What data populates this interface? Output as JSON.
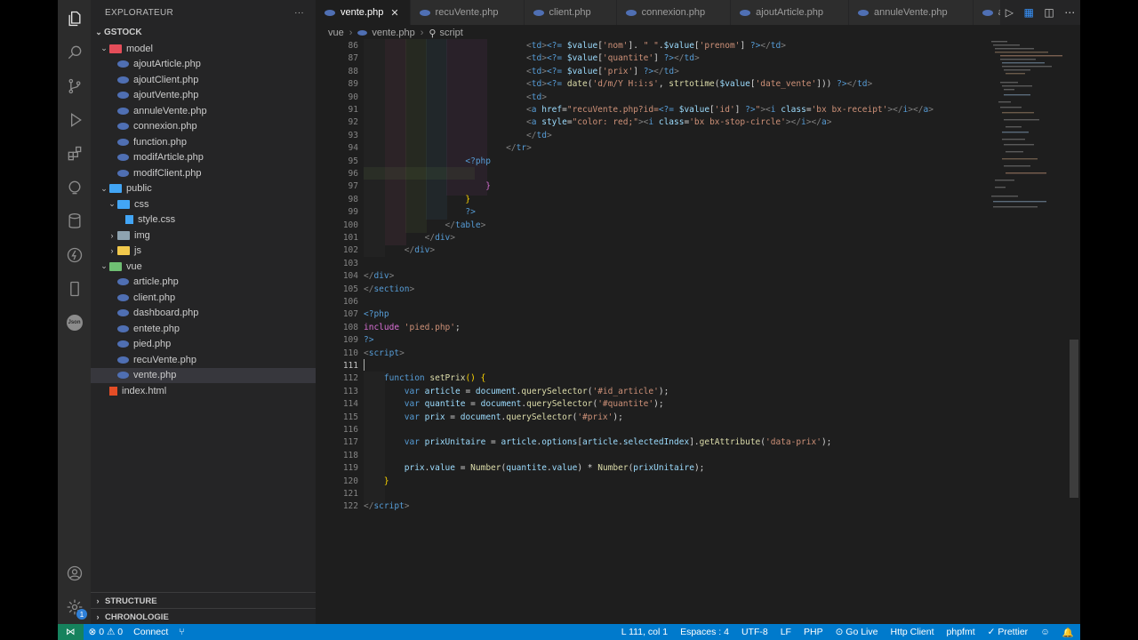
{
  "sidebar": {
    "title": "EXPLORATEUR",
    "more": "···",
    "root": "GSTOCK",
    "tree": [
      {
        "label": "model",
        "kind": "folder-red",
        "depth": 1,
        "chev": "⌄"
      },
      {
        "label": "ajoutArticle.php",
        "kind": "php",
        "depth": 2
      },
      {
        "label": "ajoutClient.php",
        "kind": "php",
        "depth": 2
      },
      {
        "label": "ajoutVente.php",
        "kind": "php",
        "depth": 2
      },
      {
        "label": "annuleVente.php",
        "kind": "php",
        "depth": 2
      },
      {
        "label": "connexion.php",
        "kind": "php",
        "depth": 2
      },
      {
        "label": "function.php",
        "kind": "php",
        "depth": 2
      },
      {
        "label": "modifArticle.php",
        "kind": "php",
        "depth": 2
      },
      {
        "label": "modifClient.php",
        "kind": "php",
        "depth": 2
      },
      {
        "label": "public",
        "kind": "folder-blue",
        "depth": 1,
        "chev": "⌄"
      },
      {
        "label": "css",
        "kind": "folder-blue",
        "depth": 2,
        "chev": "⌄"
      },
      {
        "label": "style.css",
        "kind": "css",
        "depth": 3
      },
      {
        "label": "img",
        "kind": "folder-gray",
        "depth": 2,
        "chev": "›"
      },
      {
        "label": "js",
        "kind": "folder-yellow",
        "depth": 2,
        "chev": "›"
      },
      {
        "label": "vue",
        "kind": "folder-green",
        "depth": 1,
        "chev": "⌄"
      },
      {
        "label": "article.php",
        "kind": "php",
        "depth": 2
      },
      {
        "label": "client.php",
        "kind": "php",
        "depth": 2
      },
      {
        "label": "dashboard.php",
        "kind": "php",
        "depth": 2
      },
      {
        "label": "entete.php",
        "kind": "php",
        "depth": 2
      },
      {
        "label": "pied.php",
        "kind": "php",
        "depth": 2
      },
      {
        "label": "recuVente.php",
        "kind": "php",
        "depth": 2
      },
      {
        "label": "vente.php",
        "kind": "php",
        "depth": 2,
        "selected": true
      },
      {
        "label": "index.html",
        "kind": "html",
        "depth": 1
      }
    ],
    "structure": "STRUCTURE",
    "timeline": "CHRONOLOGIE"
  },
  "tabs": [
    {
      "label": "vente.php",
      "active": true,
      "close": "✕"
    },
    {
      "label": "recuVente.php"
    },
    {
      "label": "client.php"
    },
    {
      "label": "connexion.php"
    },
    {
      "label": "ajoutArticle.php"
    },
    {
      "label": "annuleVente.php"
    },
    {
      "label": "ajoutVente"
    }
  ],
  "breadcrumb": {
    "folder": "vue",
    "sep": "›",
    "file": "vente.php",
    "symbol": "script"
  },
  "code": [
    {
      "n": "86",
      "h": "                                <span class='t'>&lt;</span><span class='tg'>td</span><span class='t'>&gt;</span><span class='k'>&lt;?=</span> <span class='v'>$value</span>[<span class='s'>'nom'</span>]. <span class='s'>\" \"</span>.<span class='v'>$value</span>[<span class='s'>'prenom'</span>] <span class='k'>?&gt;</span><span class='t'>&lt;/</span><span class='tg'>td</span><span class='t'>&gt;</span>"
    },
    {
      "n": "87",
      "h": "                                <span class='t'>&lt;</span><span class='tg'>td</span><span class='t'>&gt;</span><span class='k'>&lt;?=</span> <span class='v'>$value</span>[<span class='s'>'quantite'</span>] <span class='k'>?&gt;</span><span class='t'>&lt;/</span><span class='tg'>td</span><span class='t'>&gt;</span>"
    },
    {
      "n": "88",
      "h": "                                <span class='t'>&lt;</span><span class='tg'>td</span><span class='t'>&gt;</span><span class='k'>&lt;?=</span> <span class='v'>$value</span>[<span class='s'>'prix'</span>] <span class='k'>?&gt;</span><span class='t'>&lt;/</span><span class='tg'>td</span><span class='t'>&gt;</span>"
    },
    {
      "n": "89",
      "h": "                                <span class='t'>&lt;</span><span class='tg'>td</span><span class='t'>&gt;</span><span class='k'>&lt;?=</span> <span class='f'>date</span>(<span class='s'>'d/m/Y H:i:s'</span>, <span class='f'>strtotime</span>(<span class='v'>$value</span>[<span class='s'>'date_vente'</span>])) <span class='k'>?&gt;</span><span class='t'>&lt;/</span><span class='tg'>td</span><span class='t'>&gt;</span>"
    },
    {
      "n": "90",
      "h": "                                <span class='t'>&lt;</span><span class='tg'>td</span><span class='t'>&gt;</span>"
    },
    {
      "n": "91",
      "h": "                                <span class='t'>&lt;</span><span class='tg'>a</span> <span class='at'>href</span>=<span class='s'>\"recuVente.php?id=</span><span class='k'>&lt;?=</span> <span class='v'>$value</span>[<span class='s'>'id'</span>] <span class='k'>?&gt;</span><span class='s'>\"</span><span class='t'>&gt;&lt;</span><span class='tg'>i</span> <span class='at'>class</span>=<span class='s'>'bx bx-receipt'</span><span class='t'>&gt;&lt;/</span><span class='tg'>i</span><span class='t'>&gt;&lt;/</span><span class='tg'>a</span><span class='t'>&gt;</span>"
    },
    {
      "n": "92",
      "h": "                                <span class='t'>&lt;</span><span class='tg'>a</span> <span class='at'>style</span>=<span class='s'>\"color: red;\"</span><span class='t'>&gt;&lt;</span><span class='tg'>i</span> <span class='at'>class</span>=<span class='s'>'bx bx-stop-circle'</span><span class='t'>&gt;&lt;/</span><span class='tg'>i</span><span class='t'>&gt;&lt;/</span><span class='tg'>a</span><span class='t'>&gt;</span>"
    },
    {
      "n": "93",
      "h": "                                <span class='t'>&lt;/</span><span class='tg'>td</span><span class='t'>&gt;</span>"
    },
    {
      "n": "94",
      "h": "                            <span class='t'>&lt;/</span><span class='tg'>tr</span><span class='t'>&gt;</span>"
    },
    {
      "n": "95",
      "h": "                    <span class='k'>&lt;?php</span>"
    },
    {
      "n": "96",
      "h": ""
    },
    {
      "n": "97",
      "h": "                        <span class='p'>}</span>"
    },
    {
      "n": "98",
      "h": "                    <span class='y'>}</span>"
    },
    {
      "n": "99",
      "h": "                    <span class='k'>?&gt;</span>"
    },
    {
      "n": "100",
      "h": "                <span class='t'>&lt;/</span><span class='tg'>table</span><span class='t'>&gt;</span>"
    },
    {
      "n": "101",
      "h": "            <span class='t'>&lt;/</span><span class='tg'>div</span><span class='t'>&gt;</span>"
    },
    {
      "n": "102",
      "h": "        <span class='t'>&lt;/</span><span class='tg'>div</span><span class='t'>&gt;</span>"
    },
    {
      "n": "103",
      "h": ""
    },
    {
      "n": "104",
      "h": "<span class='t'>&lt;/</span><span class='tg'>div</span><span class='t'>&gt;</span>"
    },
    {
      "n": "105",
      "h": "<span class='t'>&lt;/</span><span class='tg'>section</span><span class='t'>&gt;</span>"
    },
    {
      "n": "106",
      "h": ""
    },
    {
      "n": "107",
      "h": "<span class='k'>&lt;?php</span>"
    },
    {
      "n": "108",
      "h": "<span class='p'>include</span> <span class='s'>'pied.php'</span>;"
    },
    {
      "n": "109",
      "h": "<span class='k'>?&gt;</span>"
    },
    {
      "n": "110",
      "h": "<span class='t'>&lt;</span><span class='tg'>script</span><span class='t'>&gt;</span>"
    },
    {
      "n": "111",
      "h": "",
      "current": true
    },
    {
      "n": "112",
      "h": "    <span class='k'>function</span> <span class='f'>setPrix</span><span class='y'>()</span> <span class='y'>{</span>"
    },
    {
      "n": "113",
      "h": "        <span class='k'>var</span> <span class='v'>article</span> = <span class='v'>document</span>.<span class='f'>querySelector</span>(<span class='s'>'#id_article'</span>);"
    },
    {
      "n": "114",
      "h": "        <span class='k'>var</span> <span class='v'>quantite</span> = <span class='v'>document</span>.<span class='f'>querySelector</span>(<span class='s'>'#quantite'</span>);"
    },
    {
      "n": "115",
      "h": "        <span class='k'>var</span> <span class='v'>prix</span> = <span class='v'>document</span>.<span class='f'>querySelector</span>(<span class='s'>'#prix'</span>);"
    },
    {
      "n": "116",
      "h": ""
    },
    {
      "n": "117",
      "h": "        <span class='k'>var</span> <span class='v'>prixUnitaire</span> = <span class='v'>article</span>.<span class='v'>options</span>[<span class='v'>article</span>.<span class='v'>selectedIndex</span>].<span class='f'>getAttribute</span>(<span class='s'>'data-prix'</span>);"
    },
    {
      "n": "118",
      "h": ""
    },
    {
      "n": "119",
      "h": "        <span class='v'>prix</span>.<span class='v'>value</span> = <span class='f'>Number</span>(<span class='v'>quantite</span>.<span class='v'>value</span>) * <span class='f'>Number</span>(<span class='v'>prixUnitaire</span>);"
    },
    {
      "n": "120",
      "h": "    <span class='y'>}</span>"
    },
    {
      "n": "121",
      "h": ""
    },
    {
      "n": "122",
      "h": "<span class='t'>&lt;/</span><span class='tg'>script</span><span class='t'>&gt;</span>"
    }
  ],
  "status": {
    "left": [
      {
        "icon": "remote-icon",
        "label": "⋈"
      },
      {
        "icon": "problems-icon",
        "label": "⊗ 0 ⚠ 0"
      },
      {
        "icon": "connect-icon",
        "label": "Connect"
      },
      {
        "icon": "git-icon",
        "label": "⑂"
      }
    ],
    "right": [
      {
        "name": "cursor-position",
        "label": "L 111, col 1"
      },
      {
        "name": "indentation",
        "label": "Espaces : 4"
      },
      {
        "name": "encoding",
        "label": "UTF-8"
      },
      {
        "name": "eol",
        "label": "LF"
      },
      {
        "name": "language",
        "label": "PHP"
      },
      {
        "name": "go-live",
        "label": "⊙ Go Live"
      },
      {
        "name": "http-client",
        "label": "Http Client"
      },
      {
        "name": "phpfmt",
        "label": "phpfmt"
      },
      {
        "name": "prettier",
        "label": "✓ Prettier"
      },
      {
        "name": "feedback",
        "label": "☺"
      },
      {
        "name": "notifications",
        "label": "🔔"
      }
    ]
  },
  "activity": {
    "account_badge": "1",
    "json_label": "Json"
  },
  "colors": {
    "statusbar": "#007acc",
    "accent": "#569cd6"
  }
}
